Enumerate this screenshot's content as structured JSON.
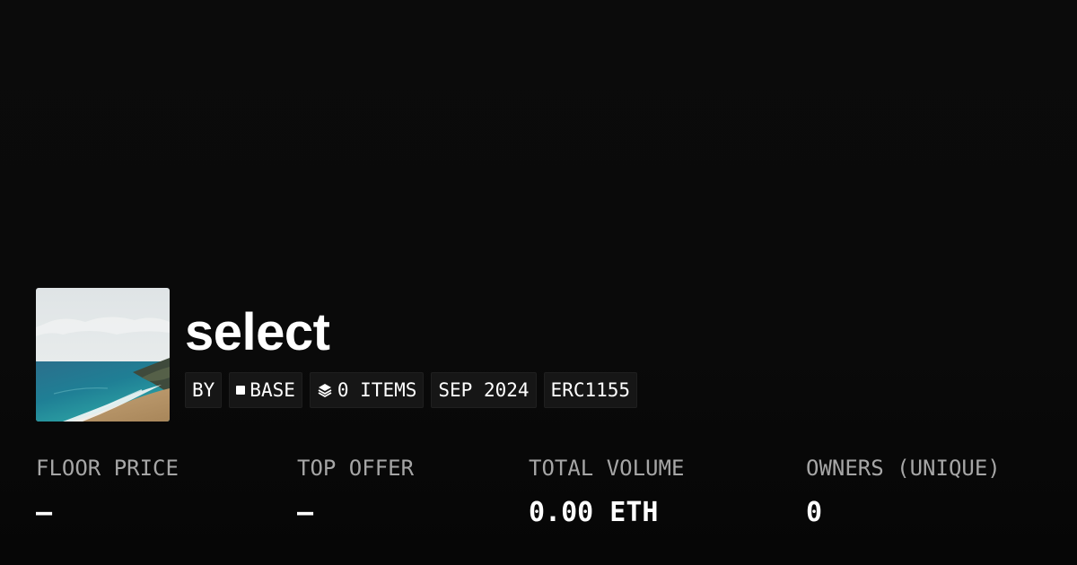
{
  "collection": {
    "name": "select",
    "thumbnail_icon": "ocean-coastline-image"
  },
  "tags": {
    "by_label": "BY",
    "chain_label": "BASE",
    "chain_icon": "square-icon",
    "items_label": "0 ITEMS",
    "items_icon": "layers-icon",
    "date_label": "SEP 2024",
    "standard_label": "ERC1155"
  },
  "stats": [
    {
      "label": "FLOOR PRICE",
      "value": "–"
    },
    {
      "label": "TOP OFFER",
      "value": "–"
    },
    {
      "label": "TOTAL VOLUME",
      "value": "0.00 ETH"
    },
    {
      "label": "OWNERS (UNIQUE)",
      "value": "0"
    }
  ],
  "colors": {
    "background": "#0a0a0a",
    "tag_background": "#161616",
    "label_gray": "#a6a6a6",
    "text": "#ffffff"
  }
}
